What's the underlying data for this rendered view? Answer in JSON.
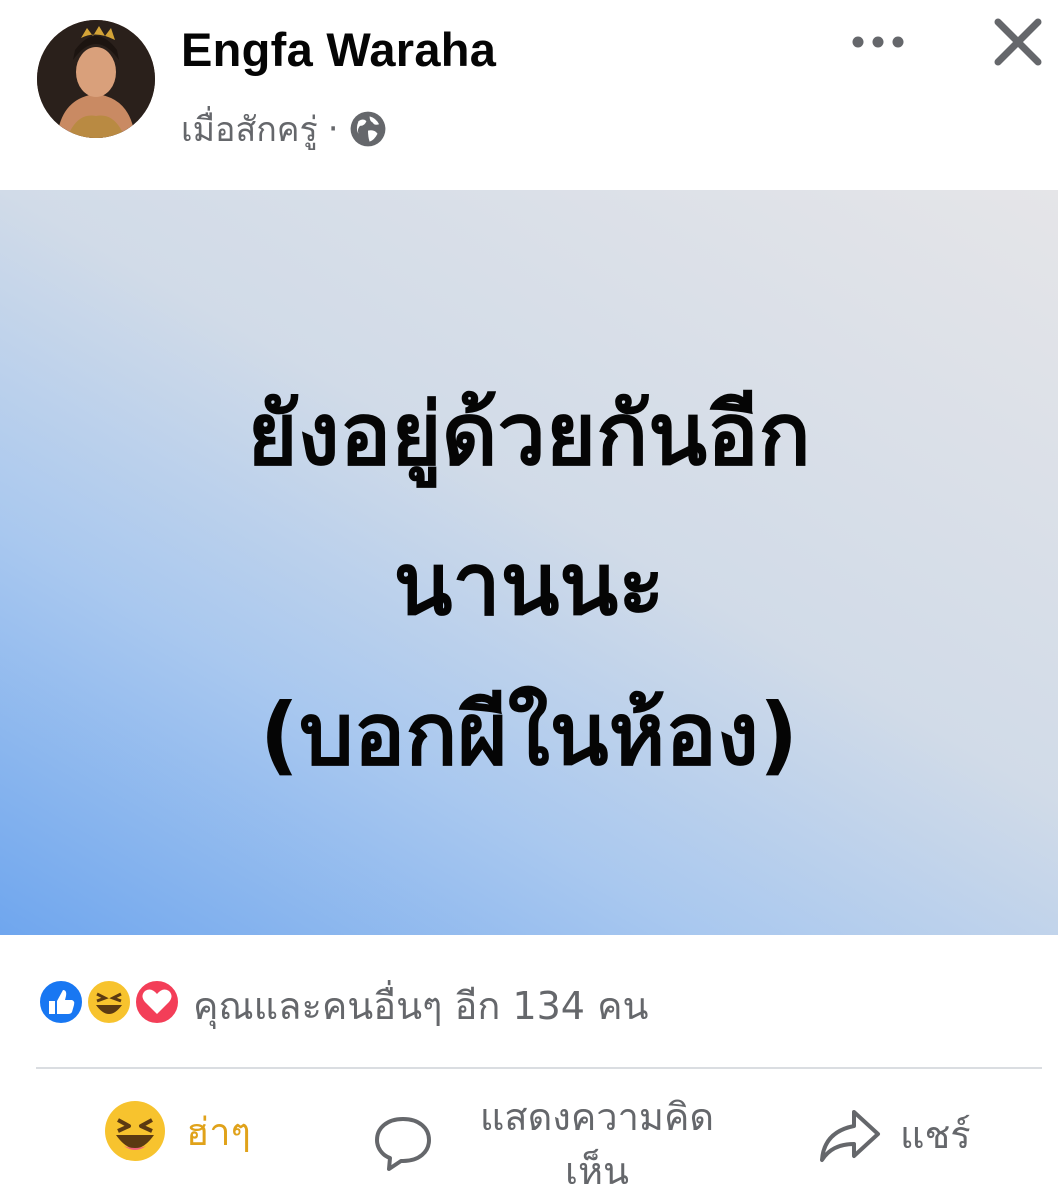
{
  "post": {
    "author": "Engfa Waraha",
    "timestamp": "เมื่อสักครู่",
    "separator": "·",
    "privacy_icon": "globe-icon",
    "text_lines": [
      "ยังอยู่ด้วยกันอีก",
      "นานนะ",
      "(บอกผีในห้อง)"
    ],
    "background_colors": [
      "#6fa6ee",
      "#e5e5e8"
    ]
  },
  "header_actions": {
    "more_icon": "more-options-icon",
    "close_icon": "close-icon"
  },
  "reactions": {
    "icons": [
      "like-icon",
      "haha-icon",
      "love-icon"
    ],
    "summary": "คุณและคนอื่นๆ อีก 134 คน"
  },
  "actions": {
    "haha_label": "ฮ่าๆ",
    "comment_label": "แสดงความคิดเห็น",
    "share_label": "แชร์"
  },
  "colors": {
    "haha_accent": "#e0a21a",
    "like_blue": "#1877f2",
    "love_red": "#f33e58",
    "muted_text": "#65676b"
  }
}
